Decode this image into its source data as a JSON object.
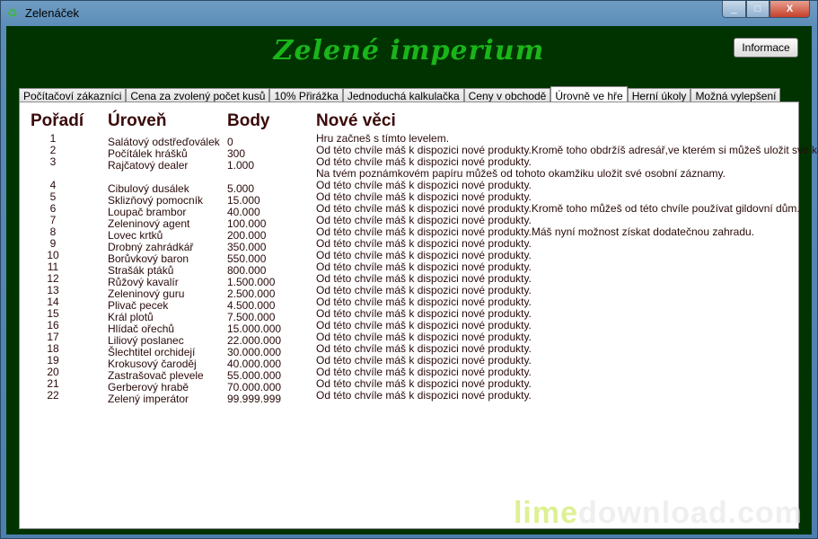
{
  "window": {
    "title": "Zelenáček",
    "icon": "recycle-icon",
    "minimize": "_",
    "maximize": "□",
    "close": "X"
  },
  "heading": "Zelené imperium",
  "info_button": "Informace",
  "tabs": [
    "Počítačoví zákazníci",
    "Cena za zvolený počet kusů",
    "10% Přirážka",
    "Jednoduchá kalkulačka",
    "Ceny v obchodě",
    "Úrovně ve hře",
    "Herní úkoly",
    "Možná vylepšení"
  ],
  "active_tab": "Úrovně ve hře",
  "table": {
    "headers": {
      "rank": "Pořadí",
      "level": "Úroveň",
      "points": "Body",
      "new": "Nové věci"
    },
    "ranks": [
      "1",
      "2",
      "3",
      "4",
      "5",
      "6",
      "7",
      "8",
      "9",
      "10",
      "11",
      "12",
      "13",
      "14",
      "15",
      "16",
      "17",
      "18",
      "19",
      "20",
      "21",
      "22"
    ],
    "names": [
      "Salátový odstřeďoválek",
      "Počítálek hrášků",
      "Rajčatový dealer",
      "Cibulový dusálek",
      "Sklizňový pomocník",
      "Loupač brambor",
      "Zeleninový agent",
      "Lovec krtků",
      "Drobný zahrádkář",
      "Borůvkový baron",
      "Strašák ptáků",
      "Růžový kavalír",
      "Zeleninový guru",
      "Plivač pecek",
      "Král plotů",
      "Hlídač ořechů",
      "Liliový poslanec",
      "Šlechtitel orchidejí",
      "Krokusový čaroděj",
      "Zastrašovač plevele",
      "Gerberový hrabě",
      "Zelený imperátor"
    ],
    "points": [
      "0",
      "300",
      "1.000",
      "5.000",
      "15.000",
      "40.000",
      "100.000",
      "200.000",
      "350.000",
      "550.000",
      "800.000",
      "1.500.000",
      "2.500.000",
      "4.500.000",
      "7.500.000",
      "15.000.000",
      "22.000.000",
      "30.000.000",
      "40.000.000",
      "55.000.000",
      "70.000.000",
      "99.999.999"
    ],
    "notes": [
      "Hru začneš s tímto levelem.",
      "Od této chvíle máš k dispozici nové produkty.Kromě toho obdržíš adresář,ve kterém si můžeš uložit své kontakty.",
      "Od této chvíle máš k dispozici nové produkty.",
      "Na tvém poznámkovém papíru můžeš od tohoto okamžiku uložit své osobní záznamy.",
      "Od této chvíle máš k dispozici nové produkty.",
      "Od této chvíle máš k dispozici nové produkty.",
      "Od této chvíle máš k dispozici nové produkty.Kromě toho můžeš od této chvíle používat gildovní dům.",
      "Od této chvíle máš k dispozici nové produkty.",
      "Od této chvíle máš k dispozici nové produkty.Máš nyní možnost získat dodatečnou zahradu.",
      "Od této chvíle máš k dispozici nové produkty.",
      "Od této chvíle máš k dispozici nové produkty.",
      "Od této chvíle máš k dispozici nové produkty.",
      "Od této chvíle máš k dispozici nové produkty.",
      "Od této chvíle máš k dispozici nové produkty.",
      "Od této chvíle máš k dispozici nové produkty.",
      "Od této chvíle máš k dispozici nové produkty.",
      "Od této chvíle máš k dispozici nové produkty.",
      "Od této chvíle máš k dispozici nové produkty.",
      "Od této chvíle máš k dispozici nové produkty.",
      "Od této chvíle máš k dispozici nové produkty.",
      "Od této chvíle máš k dispozici nové produkty.",
      "Od této chvíle máš k dispozici nové produkty.",
      "Od této chvíle máš k dispozici nové produkty."
    ]
  },
  "watermark": {
    "a": "lime",
    "b": "download.com"
  }
}
